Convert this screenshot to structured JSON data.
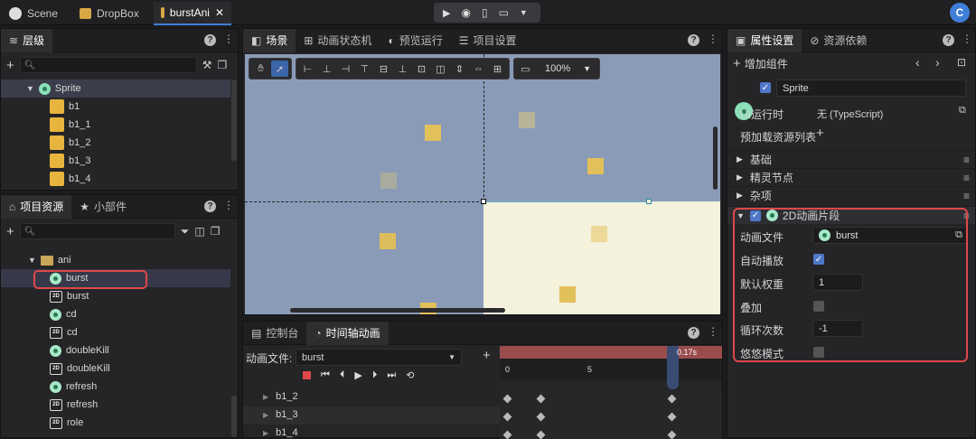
{
  "topbar": {
    "tabs": [
      {
        "label": "Scene"
      },
      {
        "label": "DropBox"
      },
      {
        "label": "burstAni"
      }
    ],
    "avatar": "C"
  },
  "hierarchy": {
    "title": "层级",
    "root": "Sprite",
    "items": [
      "b1",
      "b1_1",
      "b1_2",
      "b1_3",
      "b1_4"
    ]
  },
  "assets": {
    "tabs": [
      "项目资源",
      "小部件"
    ],
    "folder": "ani",
    "items": [
      {
        "label": "burst",
        "icon": "anim"
      },
      {
        "label": "burst",
        "icon": "2d"
      },
      {
        "label": "cd",
        "icon": "anim"
      },
      {
        "label": "cd",
        "icon": "2d"
      },
      {
        "label": "doubleKill",
        "icon": "anim"
      },
      {
        "label": "doubleKill",
        "icon": "2d"
      },
      {
        "label": "refresh",
        "icon": "anim"
      },
      {
        "label": "refresh",
        "icon": "2d"
      },
      {
        "label": "role",
        "icon": "2d"
      }
    ]
  },
  "scene": {
    "tabs": [
      "场景",
      "动画状态机",
      "预览运行",
      "项目设置"
    ],
    "zoom": "100%"
  },
  "timeline": {
    "tabs": [
      "控制台",
      "时间轴动画"
    ],
    "file_label": "动画文件:",
    "file_value": "burst",
    "ruler": [
      "0",
      "5",
      "10"
    ],
    "playhead": "0.17s",
    "tracks": [
      "b1_2",
      "b1_3",
      "b1_4"
    ]
  },
  "inspector": {
    "tabs": [
      "属性设置",
      "资源依赖"
    ],
    "add_component": "增加组件",
    "node_name": "Sprite",
    "ui_runtime_label": "UI运行时",
    "ui_runtime_value": "无 (TypeScript)",
    "preload_label": "预加载资源列表",
    "sections": [
      "基础",
      "精灵节点",
      "杂项"
    ],
    "anim_section": "2D动画片段",
    "anim_file_label": "动画文件",
    "anim_file_value": "burst",
    "autoplay_label": "自动播放",
    "weight_label": "默认权重",
    "weight_value": "1",
    "additive_label": "叠加",
    "loop_label": "循环次数",
    "loop_value": "-1",
    "yoyo_label": "悠悠模式"
  },
  "colors": {
    "highlight": "#e04848",
    "accent": "#4f78c8",
    "scene_bg": "#8a9bb8",
    "canvas_bg": "#f4f1dc",
    "sprite": "#e2c05a"
  }
}
